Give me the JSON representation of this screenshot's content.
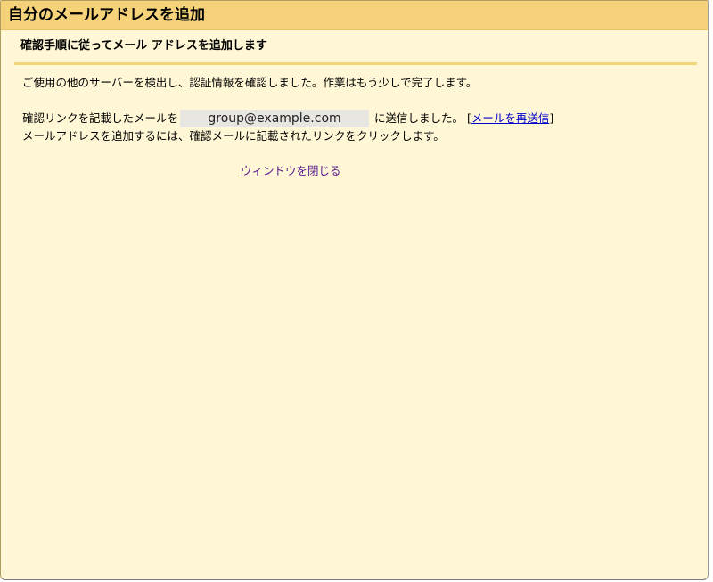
{
  "window": {
    "title": "自分のメールアドレスを追加"
  },
  "main": {
    "heading": "確認手順に従ってメール アドレスを追加します",
    "intro": "ご使用の他のサーバーを検出し、認証情報を確認しました。作業はもう少しで完了します。",
    "confirm_prefix": "確認リンクを記載したメールを",
    "email": "group@example.com",
    "confirm_suffix": "に送信しました。",
    "bracket_open": "[",
    "resend_link": "メールを再送信",
    "bracket_close": "]",
    "instruction": "メールアドレスを追加するには、確認メールに記載されたリンクをクリックします。",
    "close_link": "ウィンドウを閉じる"
  },
  "colors": {
    "titlebar": "#f6d37b",
    "background": "#fff7d6",
    "rule": "#f2d57a",
    "link": "#0000cc",
    "visited_link": "#551a8b",
    "email_box": "#e8e6e0"
  }
}
